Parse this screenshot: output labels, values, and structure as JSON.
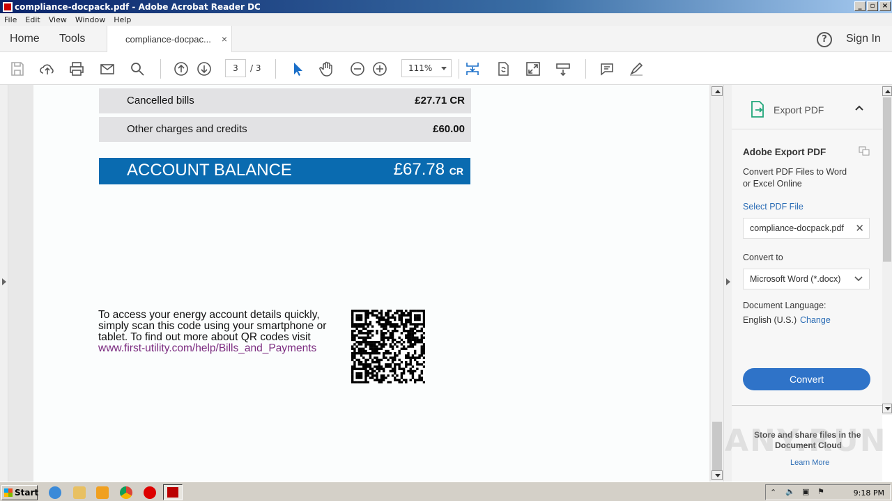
{
  "window": {
    "title": "compliance-docpack.pdf - Adobe Acrobat Reader DC",
    "controls": [
      "_",
      "▫",
      "×"
    ]
  },
  "menu": [
    "File",
    "Edit",
    "View",
    "Window",
    "Help"
  ],
  "tabs": {
    "home": "Home",
    "tools": "Tools",
    "doc": "compliance-docpac...",
    "close": "×"
  },
  "header": {
    "help": "?",
    "signin": "Sign In"
  },
  "toolbar": {
    "page_current": "3",
    "page_total": "/ 3",
    "zoom": "111%"
  },
  "document": {
    "rows": [
      {
        "label": "Cancelled bills",
        "amount": "£27.71 CR"
      },
      {
        "label": "Other charges and credits",
        "amount": "£60.00"
      }
    ],
    "balance_label": "ACCOUNT BALANCE",
    "balance_amount": "£67.78",
    "balance_suffix": "CR",
    "qr_line1": "To access your energy account details quickly,",
    "qr_line2": "simply scan this code using your smartphone or",
    "qr_line3": "tablet. To find out more about QR codes visit",
    "qr_link": "www.first-utility.com/help/Bills_and_Payments"
  },
  "panel": {
    "title": "Export PDF",
    "heading": "Adobe Export PDF",
    "desc1": "Convert PDF Files to Word",
    "desc2": "or Excel Online",
    "select_label": "Select PDF File",
    "file": "compliance-docpack.pdf",
    "convert_to": "Convert to",
    "format": "Microsoft Word (*.docx)",
    "lang_label": "Document Language:",
    "lang": "English (U.S.)",
    "change": "Change",
    "convert_btn": "Convert",
    "footer1": "Store and share files in the",
    "footer2": "Document Cloud",
    "learn": "Learn More"
  },
  "taskbar": {
    "start": "Start",
    "clock": "9:18 PM"
  },
  "watermark": "ANY.RUN"
}
